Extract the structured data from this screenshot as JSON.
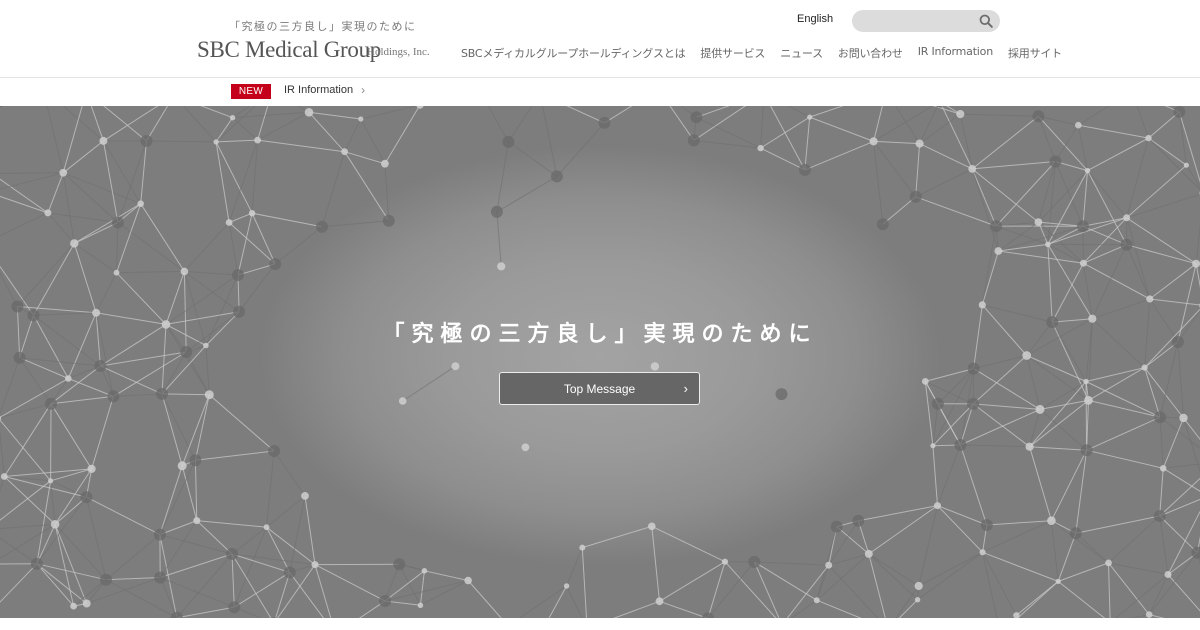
{
  "header": {
    "logo": {
      "tagline": "「究極の三方良し」実現のために",
      "name": "SBC Medical Group",
      "suffix": "Holdings, Inc."
    },
    "language_link": "English",
    "search": {
      "value": "",
      "placeholder": ""
    },
    "nav": [
      {
        "label": "SBCメディカルグループホールディングスとは"
      },
      {
        "label": "提供サービス"
      },
      {
        "label": "ニュース"
      },
      {
        "label": "お問い合わせ"
      },
      {
        "label": "IR Information"
      },
      {
        "label": "採用サイト"
      }
    ]
  },
  "news": {
    "badge": "NEW",
    "link_label": "IR Information",
    "chevron": "›"
  },
  "hero": {
    "title": "「究極の三方良し」実現のために",
    "button_label": "Top Message",
    "button_chevron": "›"
  },
  "colors": {
    "badge_red": "#c4001a",
    "hero_gray": "#9a9a9a",
    "button_gray": "#666666",
    "search_gray": "#dcdcdc"
  },
  "icons": {
    "search": "search-icon",
    "chevron": "chevron-right-icon"
  }
}
